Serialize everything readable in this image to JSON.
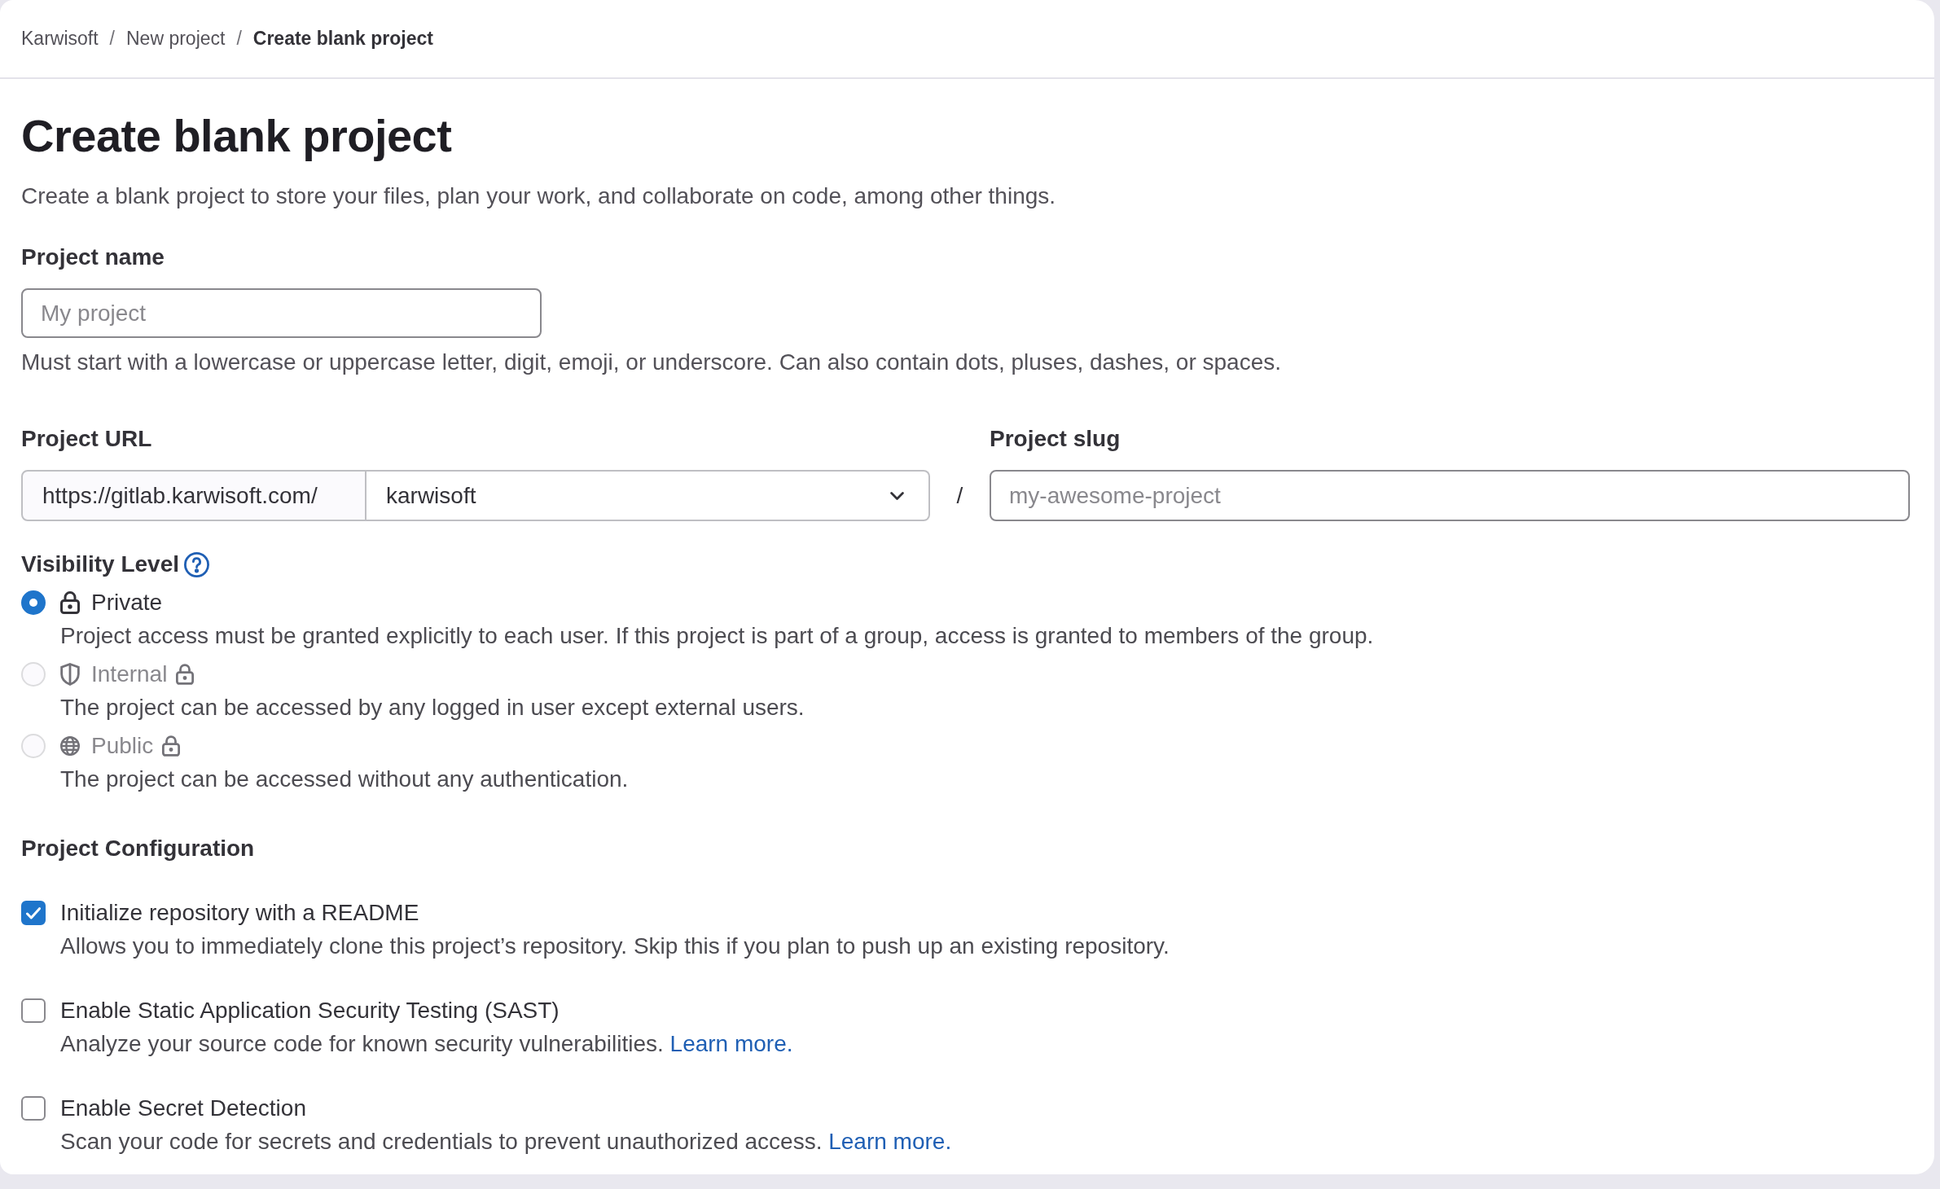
{
  "breadcrumbs": {
    "items": [
      {
        "label": "Karwisoft",
        "separator": "/",
        "current": false
      },
      {
        "label": "New project",
        "separator": "/",
        "current": false
      },
      {
        "label": "Create blank project",
        "current": true
      }
    ]
  },
  "header": {
    "title": "Create blank project",
    "description": "Create a blank project to store your files, plan your work, and collaborate on code, among other things."
  },
  "project_name": {
    "label": "Project name",
    "placeholder": "My project",
    "help": "Must start with a lowercase or uppercase letter, digit, emoji, or underscore. Can also contain dots, pluses, dashes, or spaces."
  },
  "project_url": {
    "label": "Project URL",
    "prefix": "https://gitlab.karwisoft.com/",
    "namespace": "karwisoft",
    "separator": "/"
  },
  "project_slug": {
    "label": "Project slug",
    "placeholder": "my-awesome-project"
  },
  "visibility": {
    "label": "Visibility Level",
    "options": [
      {
        "kind": "private",
        "label": "Private",
        "description": "Project access must be granted explicitly to each user. If this project is part of a group, access is granted to members of the group.",
        "selected": true,
        "disabled": false
      },
      {
        "kind": "internal",
        "label": "Internal",
        "description": "The project can be accessed by any logged in user except external users.",
        "selected": false,
        "disabled": true
      },
      {
        "kind": "public",
        "label": "Public",
        "description": "The project can be accessed without any authentication.",
        "selected": false,
        "disabled": true
      }
    ]
  },
  "configuration": {
    "label": "Project Configuration",
    "options": [
      {
        "label": "Initialize repository with a README",
        "description": "Allows you to immediately clone this project’s repository. Skip this if you plan to push up an existing repository.",
        "checked": true
      },
      {
        "label": "Enable Static Application Security Testing (SAST)",
        "description": "Analyze your source code for known security vulnerabilities.",
        "link": "Learn more.",
        "checked": false
      },
      {
        "label": "Enable Secret Detection",
        "description": "Scan your code for secrets and credentials to prevent unauthorized access.",
        "link": "Learn more.",
        "checked": false
      }
    ]
  }
}
